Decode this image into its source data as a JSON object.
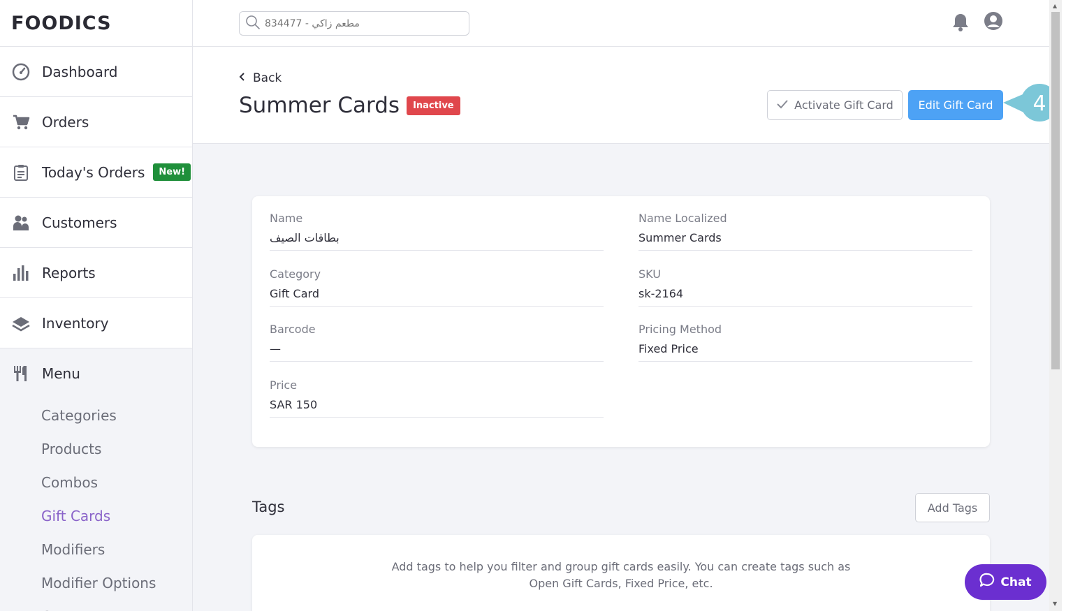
{
  "app": {
    "logo": "FOODICS"
  },
  "search": {
    "placeholder": "مطعم زاكي - 834477"
  },
  "sidebar": {
    "items": [
      {
        "label": "Dashboard",
        "icon": "gauge-icon"
      },
      {
        "label": "Orders",
        "icon": "cart-icon"
      },
      {
        "label": "Today's Orders",
        "icon": "clipboard-icon",
        "badge": "New!"
      },
      {
        "label": "Customers",
        "icon": "users-icon"
      },
      {
        "label": "Reports",
        "icon": "bar-chart-icon"
      },
      {
        "label": "Inventory",
        "icon": "layers-icon"
      }
    ],
    "menu": {
      "label": "Menu",
      "icon": "fork-knife-icon",
      "subitems": [
        "Categories",
        "Products",
        "Combos",
        "Gift Cards",
        "Modifiers",
        "Modifier Options",
        "Groups"
      ],
      "active": "Gift Cards"
    }
  },
  "header": {
    "back_label": "Back",
    "title": "Summer Cards",
    "status": "Inactive",
    "activate_label": "Activate Gift Card",
    "edit_label": "Edit Gift Card",
    "step_number": "4"
  },
  "details": {
    "name": {
      "label": "Name",
      "value": "بطاقات الصيف"
    },
    "name_localized": {
      "label": "Name Localized",
      "value": "Summer Cards"
    },
    "category": {
      "label": "Category",
      "value": "Gift Card"
    },
    "sku": {
      "label": "SKU",
      "value": "sk-2164"
    },
    "barcode": {
      "label": "Barcode",
      "value": "—"
    },
    "pricing_method": {
      "label": "Pricing Method",
      "value": "Fixed Price"
    },
    "price": {
      "label": "Price",
      "value": "SAR 150"
    }
  },
  "tags": {
    "title": "Tags",
    "add_label": "Add Tags",
    "description": "Add tags to help you filter and group gift cards easily. You can create tags such as Open Gift Cards, Fixed Price, etc."
  },
  "chat": {
    "label": "Chat"
  },
  "colors": {
    "accent_blue": "#4da2f5",
    "inactive_red": "#e0474c",
    "new_green": "#1f8f3a",
    "active_purple": "#8a63c9",
    "chat_purple": "#6b2fd0",
    "step_teal": "#7cc7d8"
  }
}
